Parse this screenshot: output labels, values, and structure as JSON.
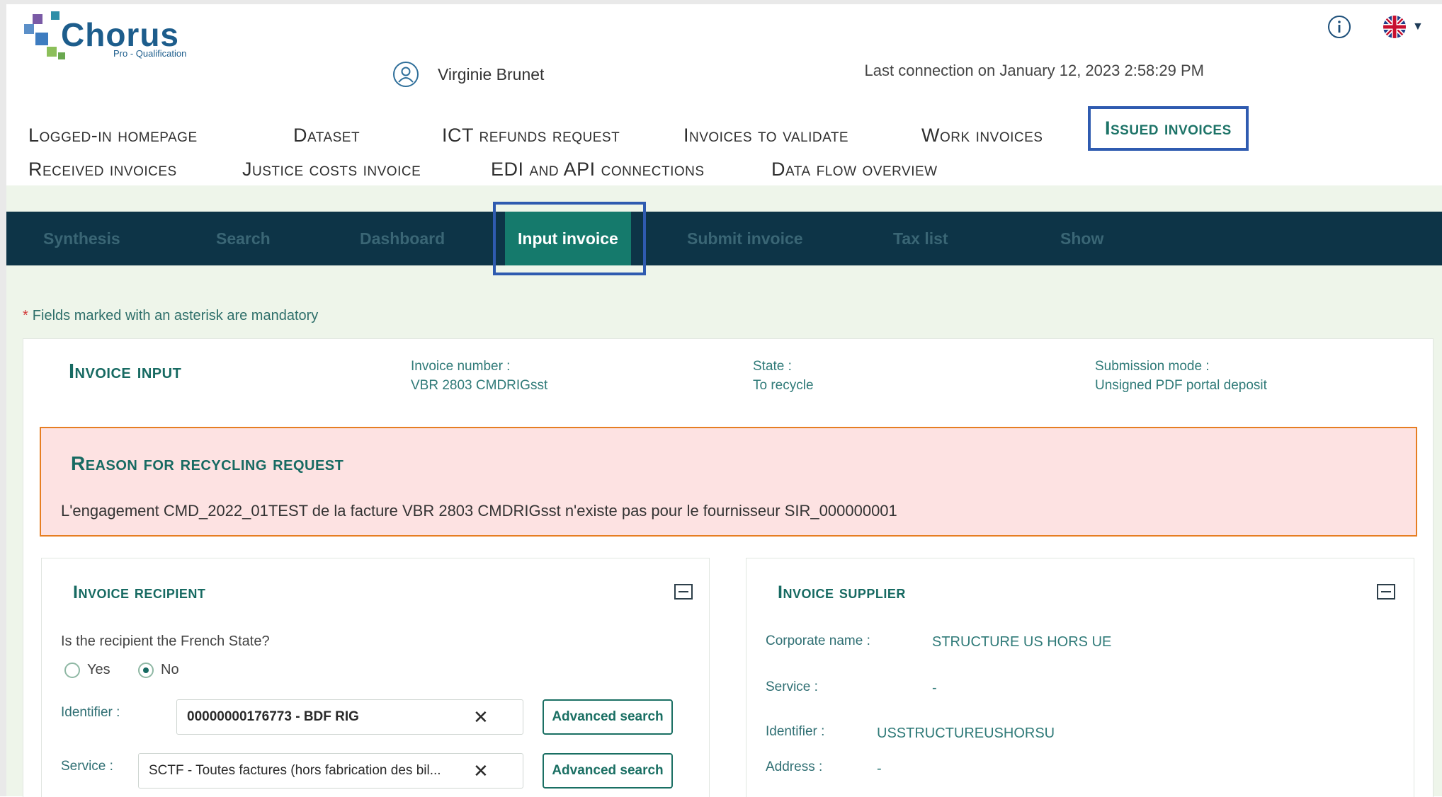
{
  "header": {
    "logo_text": "Chorus",
    "logo_sub": "Pro - Qualification",
    "user_name": "Virginie Brunet",
    "last_connection": "Last connection on January 12, 2023 2:58:29 PM"
  },
  "main_nav": [
    {
      "label": "Logged-in homepage"
    },
    {
      "label": "Dataset"
    },
    {
      "label": "ICT refunds request"
    },
    {
      "label": "Invoices to validate"
    },
    {
      "label": "Work invoices"
    },
    {
      "label": "Issued invoices"
    },
    {
      "label": "Received invoices"
    },
    {
      "label": "Justice costs invoice"
    },
    {
      "label": "EDI and API connections"
    },
    {
      "label": "Data flow overview"
    }
  ],
  "sub_nav": [
    {
      "label": "Synthesis"
    },
    {
      "label": "Search"
    },
    {
      "label": "Dashboard"
    },
    {
      "label": "Input invoice"
    },
    {
      "label": "Submit invoice"
    },
    {
      "label": "Tax list"
    },
    {
      "label": "Show"
    }
  ],
  "mandatory_note": "Fields marked with an asterisk are mandatory",
  "invoice_input": {
    "title": "Invoice input",
    "invoice_number_label": "Invoice number :",
    "invoice_number": "VBR 2803 CMDRIGsst",
    "state_label": "State :",
    "state": "To recycle",
    "submission_mode_label": "Submission mode :",
    "submission_mode": "Unsigned PDF portal deposit"
  },
  "recycling": {
    "title": "Reason for recycling request",
    "message": "L'engagement CMD_2022_01TEST de la facture VBR 2803 CMDRIGsst n'existe pas pour le fournisseur SIR_000000001"
  },
  "recipient": {
    "title": "Invoice recipient",
    "question": "Is the recipient the French State?",
    "yes_label": "Yes",
    "no_label": "No",
    "identifier_label": "Identifier :",
    "identifier_value": "00000000176773 - BDF RIG",
    "service_label": "Service :",
    "service_value": "SCTF - Toutes factures (hors fabrication des bil...",
    "advanced_search": "Advanced search"
  },
  "supplier": {
    "title": "Invoice supplier",
    "corporate_name_label": "Corporate name :",
    "corporate_name": "STRUCTURE US HORS UE",
    "service_label": "Service :",
    "service_value": "-",
    "identifier_label": "Identifier :",
    "identifier_value": "USSTRUCTUREUSHORSU",
    "address_label": "Address :",
    "address_value": "-"
  },
  "colors": {
    "accent": "#157a6c",
    "subnav_bg": "#0d3447",
    "highlight_frame": "#2f5bb0",
    "alert_bg": "#fde2e2",
    "alert_border": "#e67e22"
  }
}
